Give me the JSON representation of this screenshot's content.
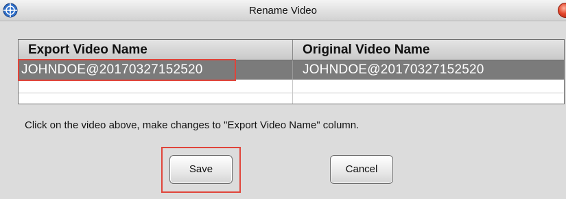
{
  "window": {
    "title": "Rename Video",
    "app_icon": "crosshair-globe-icon",
    "close_icon": "close-icon"
  },
  "grid": {
    "columns": [
      "Export Video Name",
      "Original Video Name"
    ],
    "rows": [
      {
        "export_name": "JOHNDOE@20170327152520",
        "original_name": "JOHNDOE@20170327152520",
        "selected": true
      },
      {
        "export_name": "",
        "original_name": "",
        "selected": false
      },
      {
        "export_name": "",
        "original_name": "",
        "selected": false
      }
    ]
  },
  "instruction": "Click on the video above, make changes to \"Export Video Name\" column.",
  "buttons": {
    "save_label": "Save",
    "cancel_label": "Cancel"
  },
  "colors": {
    "selected_row": "#7b7b7b",
    "highlight_outline": "#e0443a",
    "window_background": "#dcdcdc"
  }
}
